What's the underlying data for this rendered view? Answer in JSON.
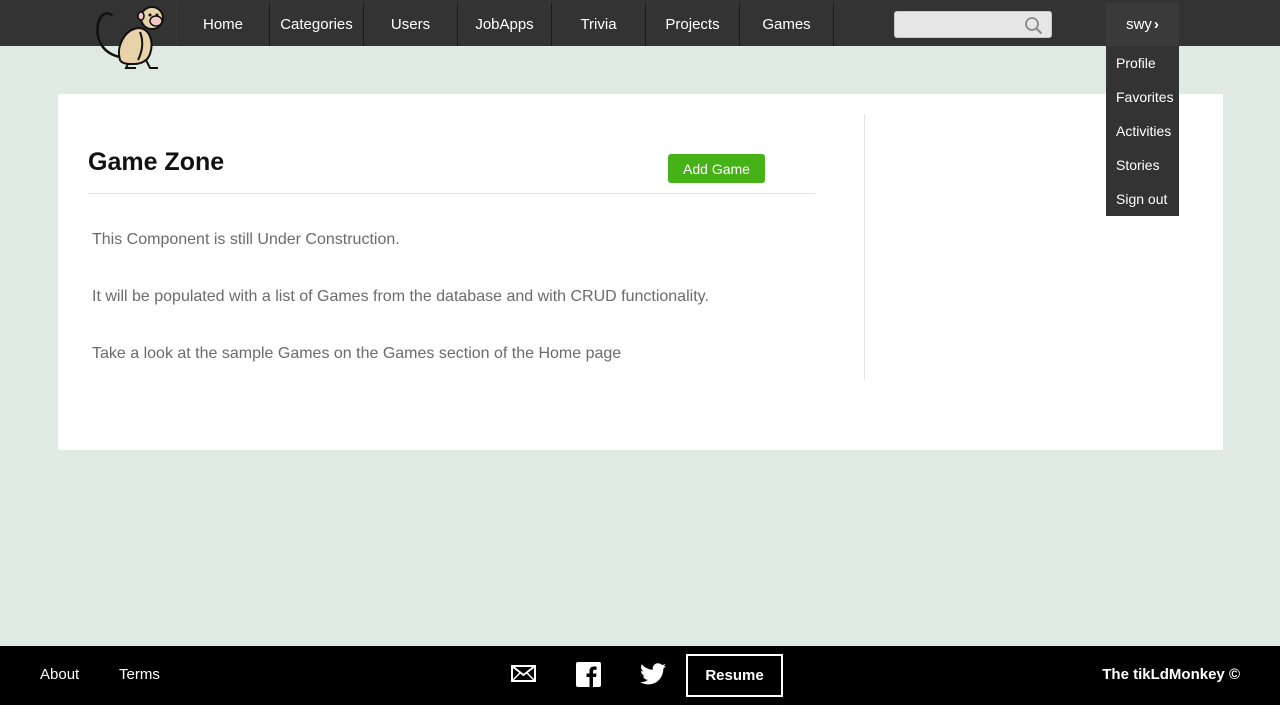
{
  "nav": {
    "items": [
      {
        "label": "Home"
      },
      {
        "label": "Categories"
      },
      {
        "label": "Users"
      },
      {
        "label": "JobApps"
      },
      {
        "label": "Trivia"
      },
      {
        "label": "Projects"
      },
      {
        "label": "Games"
      }
    ],
    "search": {
      "value": "",
      "placeholder": "",
      "icon": "search-icon"
    },
    "user": {
      "label": "swy",
      "icon": "chevron-right-icon"
    },
    "dropdown": [
      {
        "label": "Profile"
      },
      {
        "label": "Favorites"
      },
      {
        "label": "Activities"
      },
      {
        "label": "Stories"
      },
      {
        "label": "Sign out"
      }
    ]
  },
  "main": {
    "title": "Game Zone",
    "add_button": "Add Game",
    "paragraphs": [
      "This Component is still Under Construction.",
      "It will be populated with a list of Games from the database and with CRUD functionality.",
      "Take a look at the sample Games on the Games section of the Home page"
    ]
  },
  "footer": {
    "about": "About",
    "terms": "Terms",
    "icons": [
      "mail-icon",
      "facebook-icon",
      "twitter-icon"
    ],
    "resume": "Resume",
    "copyright": "The tikLdMonkey ©"
  },
  "colors": {
    "background": "#dfeae4",
    "nav": "#333333",
    "accent": "#46b217",
    "footer": "#000000"
  }
}
